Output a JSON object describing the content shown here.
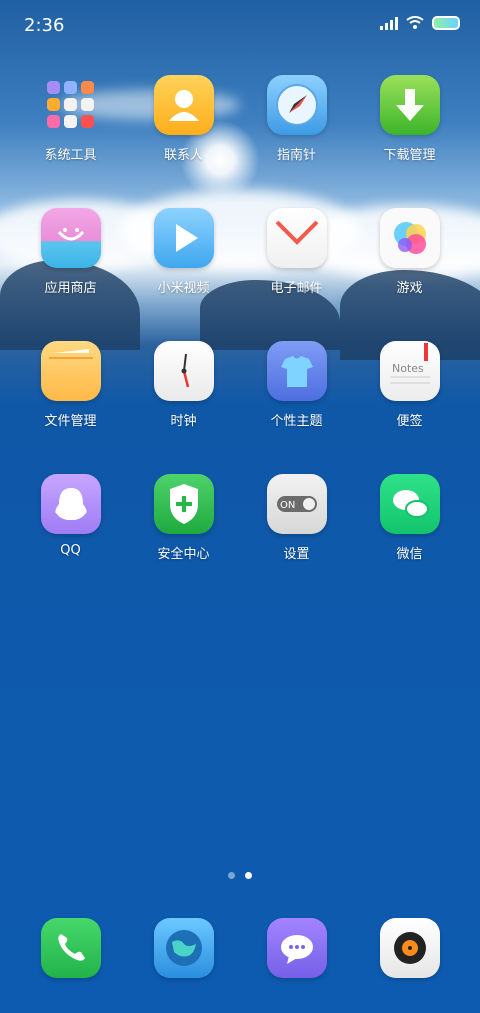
{
  "status": {
    "time": "2:36"
  },
  "apps": [
    {
      "label": "系统工具",
      "icon": "system-tools-icon"
    },
    {
      "label": "联系人",
      "icon": "contacts-icon"
    },
    {
      "label": "指南针",
      "icon": "compass-icon"
    },
    {
      "label": "下载管理",
      "icon": "download-icon"
    },
    {
      "label": "应用商店",
      "icon": "app-store-icon"
    },
    {
      "label": "小米视频",
      "icon": "video-icon"
    },
    {
      "label": "电子邮件",
      "icon": "mail-icon"
    },
    {
      "label": "游戏",
      "icon": "games-icon"
    },
    {
      "label": "文件管理",
      "icon": "file-manager-icon"
    },
    {
      "label": "时钟",
      "icon": "clock-icon"
    },
    {
      "label": "个性主题",
      "icon": "themes-icon"
    },
    {
      "label": "便签",
      "icon": "notes-icon",
      "icon_text": "Notes"
    },
    {
      "label": "QQ",
      "icon": "qq-icon"
    },
    {
      "label": "安全中心",
      "icon": "security-icon"
    },
    {
      "label": "设置",
      "icon": "settings-icon",
      "icon_text": "ON"
    },
    {
      "label": "微信",
      "icon": "wechat-icon"
    }
  ],
  "dock": [
    {
      "icon": "phone-icon"
    },
    {
      "icon": "browser-icon"
    },
    {
      "icon": "messages-icon"
    },
    {
      "icon": "music-icon"
    }
  ],
  "page_indicator": {
    "count": 2,
    "active": 2
  }
}
